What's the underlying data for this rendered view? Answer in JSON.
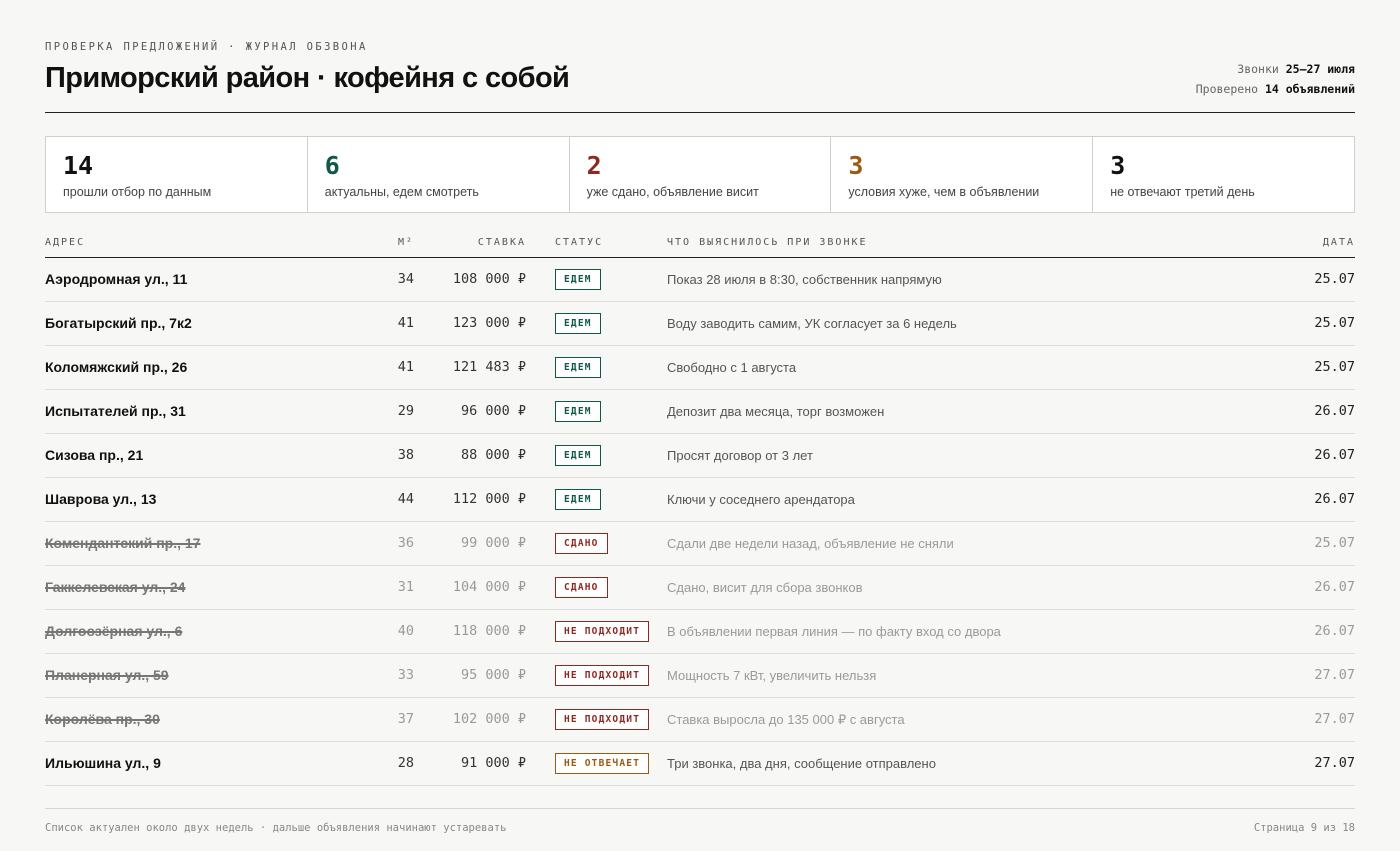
{
  "header": {
    "kicker": "ПРОВЕРКА ПРЕДЛОЖЕНИЙ · ЖУРНАЛ ОБЗВОНА",
    "title": "Приморский район · кофейня с собой",
    "calls_label": "Звонки",
    "calls_value": "25–27 июля",
    "checked_label": "Проверено",
    "checked_value": "14 объявлений"
  },
  "stats": [
    {
      "value": "14",
      "label": "прошли отбор по данным",
      "color": "#111111"
    },
    {
      "value": "6",
      "label": "актуальны, едем смотреть",
      "color": "#11574a"
    },
    {
      "value": "2",
      "label": "уже сдано, объявление висит",
      "color": "#8c2a22"
    },
    {
      "value": "3",
      "label": "условия хуже, чем в объявлении",
      "color": "#9a5a12"
    },
    {
      "value": "3",
      "label": "не отвечают третий день",
      "color": "#111111"
    }
  ],
  "table": {
    "headers": {
      "address": "АДРЕС",
      "area": "М²",
      "rate": "СТАВКА",
      "status": "СТАТУС",
      "note": "ЧТО ВЫЯСНИЛОСЬ ПРИ ЗВОНКЕ",
      "date": "ДАТА"
    },
    "rows": [
      {
        "address": "Аэродромная ул., 11",
        "area": "34",
        "rate": "108 000 ₽",
        "status": "ЕДЕМ",
        "status_kind": "go",
        "note": "Показ 28 июля в 8:30, собственник напрямую",
        "date": "25.07",
        "struck": false
      },
      {
        "address": "Богатырский пр., 7к2",
        "area": "41",
        "rate": "123 000 ₽",
        "status": "ЕДЕМ",
        "status_kind": "go",
        "note": "Воду заводить самим, УК согласует за 6 недель",
        "date": "25.07",
        "struck": false
      },
      {
        "address": "Коломяжский пр., 26",
        "area": "41",
        "rate": "121 483 ₽",
        "status": "ЕДЕМ",
        "status_kind": "go",
        "note": "Свободно с 1 августа",
        "date": "25.07",
        "struck": false
      },
      {
        "address": "Испытателей пр., 31",
        "area": "29",
        "rate": "96 000 ₽",
        "status": "ЕДЕМ",
        "status_kind": "go",
        "note": "Депозит два месяца, торг возможен",
        "date": "26.07",
        "struck": false
      },
      {
        "address": "Сизова пр., 21",
        "area": "38",
        "rate": "88 000 ₽",
        "status": "ЕДЕМ",
        "status_kind": "go",
        "note": "Просят договор от 3 лет",
        "date": "26.07",
        "struck": false
      },
      {
        "address": "Шаврова ул., 13",
        "area": "44",
        "rate": "112 000 ₽",
        "status": "ЕДЕМ",
        "status_kind": "go",
        "note": "Ключи у соседнего арендатора",
        "date": "26.07",
        "struck": false
      },
      {
        "address": "Комендантский пр., 17",
        "area": "36",
        "rate": "99 000 ₽",
        "status": "СДАНО",
        "status_kind": "rented",
        "note": "Сдали две недели назад, объявление не сняли",
        "date": "25.07",
        "struck": true
      },
      {
        "address": "Гаккелевская ул., 24",
        "area": "31",
        "rate": "104 000 ₽",
        "status": "СДАНО",
        "status_kind": "rented",
        "note": "Сдано, висит для сбора звонков",
        "date": "26.07",
        "struck": true
      },
      {
        "address": "Долгоозёрная ул., 6",
        "area": "40",
        "rate": "118 000 ₽",
        "status": "НЕ ПОДХОДИТ",
        "status_kind": "unfit",
        "note": "В объявлении первая линия — по факту вход со двора",
        "date": "26.07",
        "struck": true
      },
      {
        "address": "Планерная ул., 59",
        "area": "33",
        "rate": "95 000 ₽",
        "status": "НЕ ПОДХОДИТ",
        "status_kind": "unfit",
        "note": "Мощность 7 кВт, увеличить нельзя",
        "date": "27.07",
        "struck": true
      },
      {
        "address": "Королёва пр., 30",
        "area": "37",
        "rate": "102 000 ₽",
        "status": "НЕ ПОДХОДИТ",
        "status_kind": "unfit",
        "note": "Ставка выросла до 135 000 ₽ с августа",
        "date": "27.07",
        "struck": true
      },
      {
        "address": "Ильюшина ул., 9",
        "area": "28",
        "rate": "91 000 ₽",
        "status": "НЕ ОТВЕЧАЕТ",
        "status_kind": "noreply",
        "note": "Три звонка, два дня, сообщение отправлено",
        "date": "27.07",
        "struck": false
      }
    ]
  },
  "footer": {
    "note": "Список актуален около двух недель · дальше объявления начинают устаревать",
    "page": "Страница 9 из 18"
  }
}
